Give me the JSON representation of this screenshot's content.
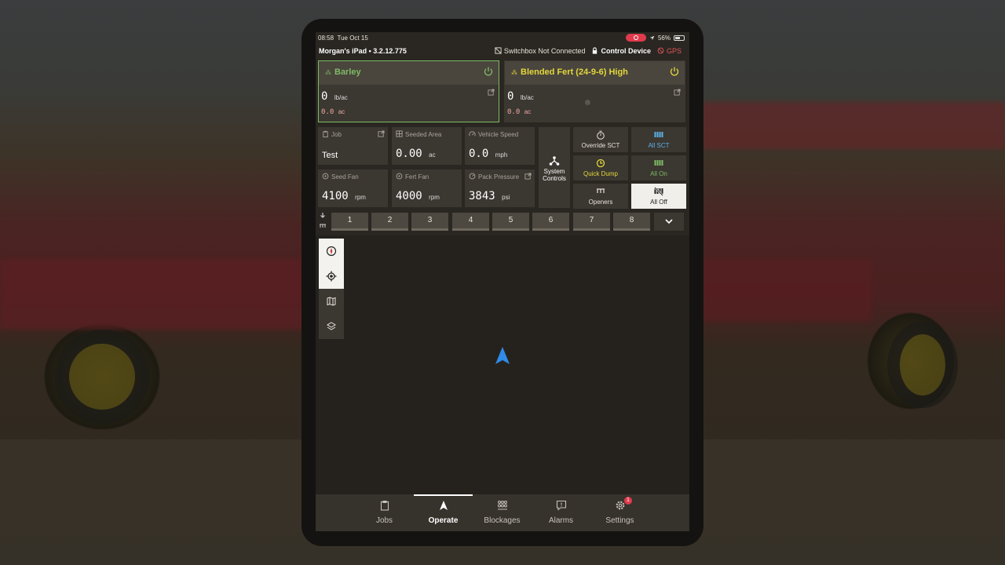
{
  "status": {
    "time": "08:58",
    "date": "Tue Oct 15",
    "battery": "56%"
  },
  "device": {
    "name": "Morgan's iPad • 3.2.12.775",
    "switchbox": "Switchbox Not Connected",
    "control": "Control Device",
    "gps": "GPS"
  },
  "products": [
    {
      "name": "Barley",
      "rate": "0",
      "rate_unit": "lb/ac",
      "area": "0.0",
      "area_unit": "ac",
      "color": "#7dbb64"
    },
    {
      "name": "Blended Fert (24-9-6) High",
      "rate": "0",
      "rate_unit": "lb/ac",
      "area": "0.0",
      "area_unit": "ac",
      "color": "#e3d73c"
    }
  ],
  "metrics": {
    "job": {
      "label": "Job",
      "value": "Test"
    },
    "seeded_area": {
      "label": "Seeded Area",
      "value": "0.00",
      "unit": "ac"
    },
    "vehicle_speed": {
      "label": "Vehicle Speed",
      "value": "0.0",
      "unit": "mph"
    },
    "seed_fan": {
      "label": "Seed Fan",
      "value": "4100",
      "unit": "rpm"
    },
    "fert_fan": {
      "label": "Fert Fan",
      "value": "4000",
      "unit": "rpm"
    },
    "pack_pressure": {
      "label": "Pack Pressure",
      "value": "3843",
      "unit": "psi"
    }
  },
  "system_controls": "System Controls",
  "controls": {
    "override_sct": "Override SCT",
    "all_sct": "All SCT",
    "quick_dump": "Quick Dump",
    "all_on": "All On",
    "openers": "Openers",
    "all_off": "All Off"
  },
  "sections": [
    "1",
    "2",
    "3",
    "4",
    "5",
    "6",
    "7",
    "8"
  ],
  "nav": {
    "jobs": "Jobs",
    "operate": "Operate",
    "blockages": "Blockages",
    "alarms": "Alarms",
    "settings": "Settings",
    "settings_badge": "1"
  },
  "colors": {
    "accent_green": "#7dbb64",
    "accent_yellow": "#e3d73c",
    "accent_blue": "#5bb0e8",
    "alert_red": "#e03a4c",
    "nav_arrow": "#2f8be6"
  }
}
